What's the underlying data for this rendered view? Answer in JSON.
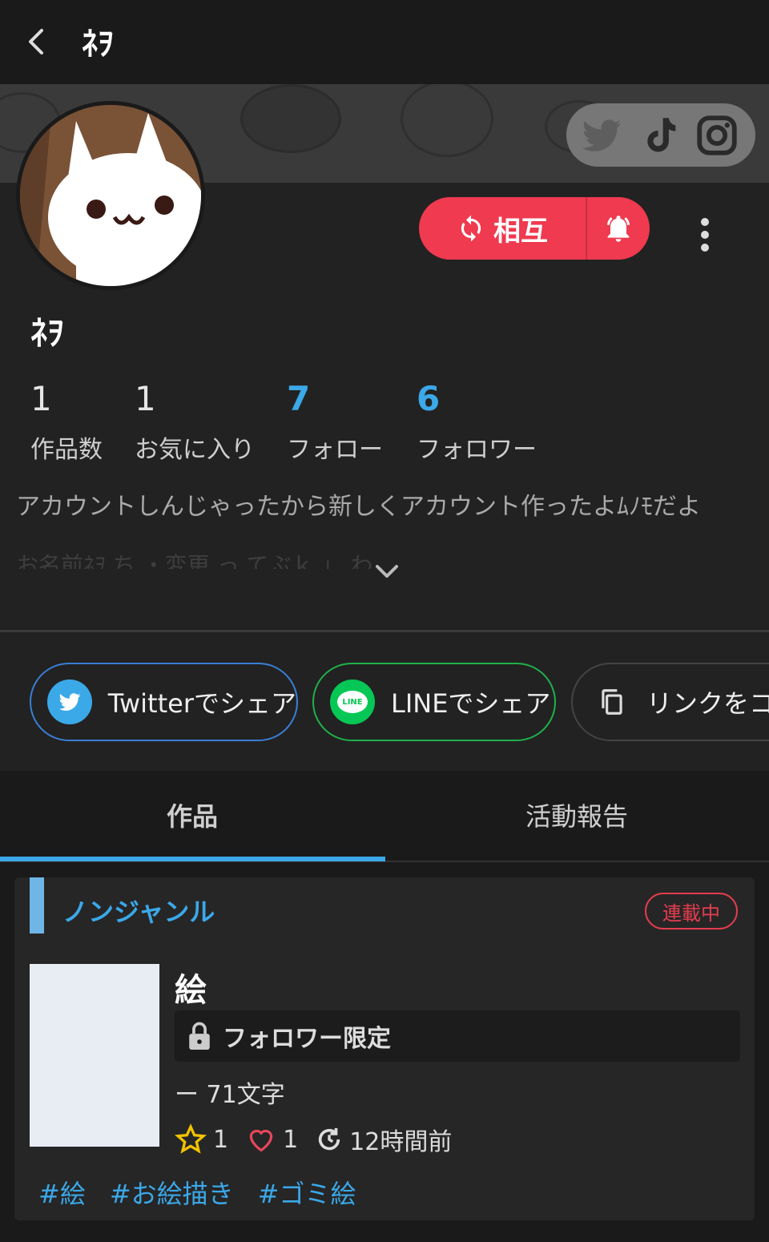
{
  "header": {
    "title": "ﾈｦ"
  },
  "profile": {
    "name": "ﾈｦ",
    "mutual_label": "相互",
    "stats": [
      {
        "num": "1",
        "label": "作品数"
      },
      {
        "num": "1",
        "label": "お気に入り"
      },
      {
        "num": "7",
        "label": "フォロー"
      },
      {
        "num": "6",
        "label": "フォロワー"
      }
    ],
    "bio": "アカウントしんじゃったから新しくアカウント作ったよﾑﾉﾓだよ",
    "bio_faded": "お名前ﾈｦ ち ・変更 っ てぶｋ 」 わ"
  },
  "share": {
    "twitter": "Twitterでシェア",
    "line": "LINEでシェア",
    "link": "リンクをコピー",
    "line_badge": "LINE"
  },
  "tabs": {
    "works": "作品",
    "activity": "活動報告"
  },
  "work": {
    "genre": "ノンジャンル",
    "status": "連載中",
    "title": "絵",
    "limited": "フォロワー限定",
    "chars": "ー 71文字",
    "stars": "1",
    "hearts": "1",
    "updated": "12時間前",
    "tags": [
      "#絵",
      "#お絵描き",
      "#ゴミ絵"
    ]
  },
  "colors": {
    "accent_blue": "#3ba8e8",
    "mutual_red": "#ef3a4f",
    "serial_red": "#e43d4e",
    "line_green": "#1fb14a",
    "twitter_blue": "#3a7fd6"
  }
}
